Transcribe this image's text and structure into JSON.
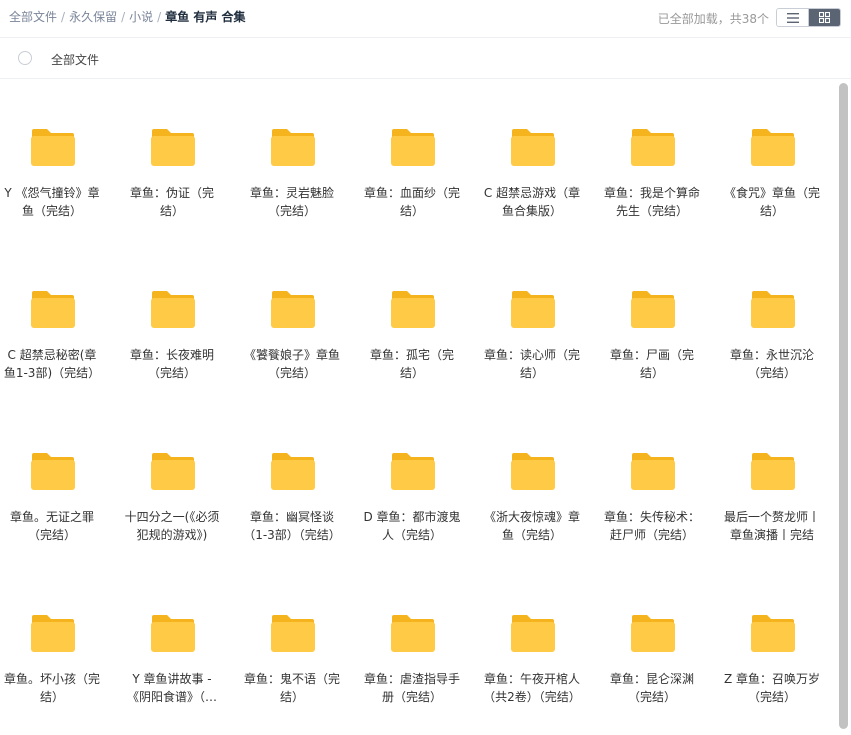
{
  "breadcrumb": {
    "items": [
      "全部文件",
      "永久保留",
      "小说"
    ],
    "current": "章鱼 有声 合集"
  },
  "status_text": "已全部加载，共38个",
  "select_all_label": "全部文件",
  "colors": {
    "folder_main": "#ffcb47",
    "folder_back": "#f5b31e",
    "active_view": "#5b6473"
  },
  "icons": {
    "list_view": "list-icon",
    "grid_view": "grid-icon",
    "folder": "folder-icon"
  },
  "folders": [
    "Y 《怨气撞铃》章鱼（完结）",
    "章鱼：伪证（完结）",
    "章鱼：灵岩魅脸（完结）",
    "章鱼：血面纱（完结）",
    "C 超禁忌游戏（章鱼合集版）",
    "章鱼：我是个算命先生（完结）",
    "《食咒》章鱼（完结）",
    "C 超禁忌秘密(章鱼1-3部)（完结）",
    "章鱼：长夜难明（完结）",
    "《饕餮娘子》章鱼（完结）",
    "章鱼：孤宅（完结）",
    "章鱼：读心师（完结）",
    "章鱼：尸画（完结）",
    "章鱼：永世沉沦（完结）",
    "章鱼。无证之罪（完结）",
    "十四分之一(《必须犯规的游戏》)",
    "章鱼：幽冥怪谈（1-3部）（完结）",
    "D 章鱼：都市渡鬼人（完结）",
    "《浙大夜惊魂》章鱼（完结）",
    "章鱼：失传秘术：赶尸师（完结）",
    "最后一个赘龙师丨章鱼演播丨完结",
    "章鱼。坏小孩（完结）",
    "Y 章鱼讲故事 -《阴阳食谱》（完结）",
    "章鱼：鬼不语（完结）",
    "章鱼：虐渣指导手册（完结）",
    "章鱼：午夜开棺人（共2卷）（完结）",
    "章鱼：昆仑深渊（完结）",
    "Z 章鱼：召唤万岁（完结）"
  ]
}
